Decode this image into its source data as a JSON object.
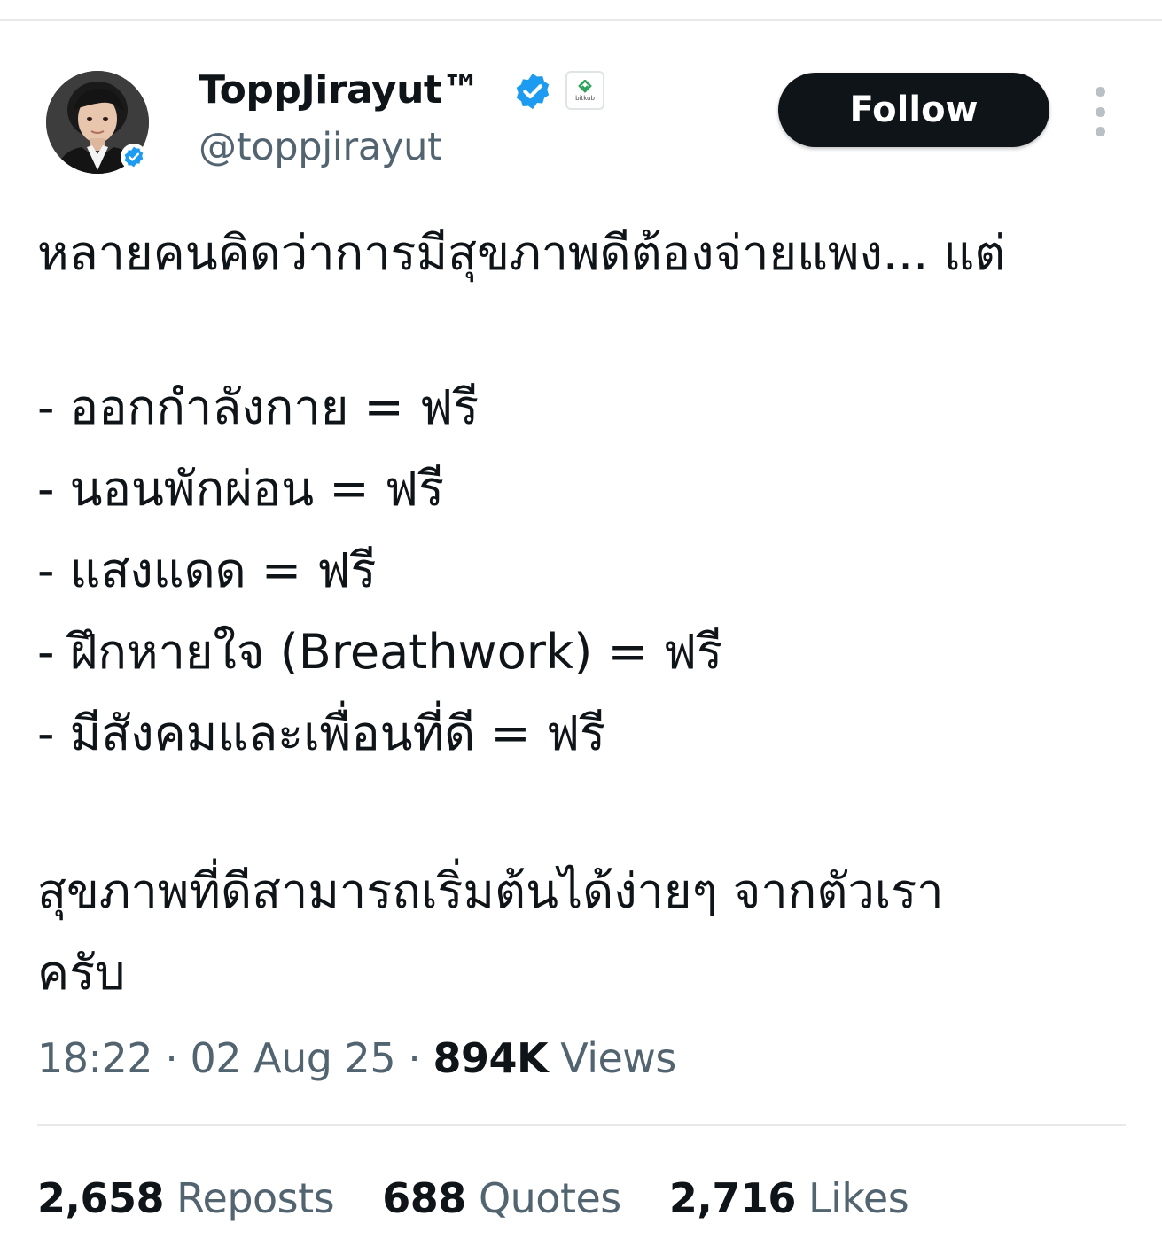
{
  "author": {
    "display_name": "ToppJirayut™",
    "handle": "@toppjirayut",
    "affiliate_label": "bitkub",
    "avatar_icon": "avatar-photo",
    "verified_icon": "verified-badge-icon",
    "verified_color": "#1d9bf0",
    "affiliate_color": "#2ea25a"
  },
  "actions": {
    "follow_label": "Follow",
    "more_icon": "more-vertical-icon"
  },
  "tweet": {
    "lines": [
      "หลายคนคิดว่าการมีสุขภาพดีต้องจ่ายแพง... แต่",
      "- ออกกำลังกาย = ฟรี",
      "- นอนพักผ่อน = ฟรี",
      "- แสงแดด = ฟรี",
      "- ฝึกหายใจ (Breathwork) = ฟรี",
      "- มีสังคมและเพื่อนที่ดี = ฟรี",
      "สุขภาพที่ดีสามารถเริ่มต้นได้ง่ายๆ จากตัวเรา",
      "ครับ"
    ]
  },
  "meta": {
    "time": "18:22",
    "separator": "·",
    "date": "02 Aug 25",
    "views_count": "894K",
    "views_label": "Views"
  },
  "stats": {
    "reposts_count": "2,658",
    "reposts_label": "Reposts",
    "quotes_count": "688",
    "quotes_label": "Quotes",
    "likes_count": "2,716",
    "likes_label": "Likes"
  }
}
